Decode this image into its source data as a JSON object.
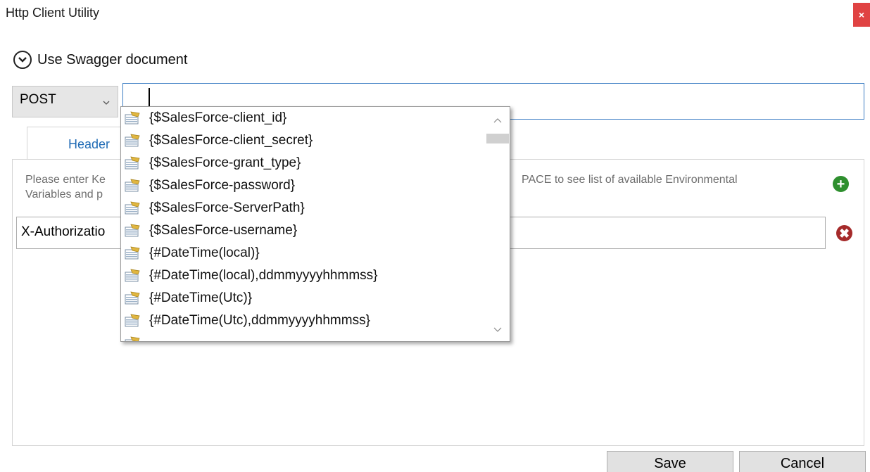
{
  "window": {
    "title": "Http Client Utility",
    "close_label": "×"
  },
  "swagger": {
    "label": "Use Swagger document"
  },
  "request": {
    "method": "POST",
    "url": ""
  },
  "tabs": [
    {
      "label": "Header"
    }
  ],
  "headers_panel": {
    "hint_left_line1": "Please enter Ke",
    "hint_left_line2": "Variables and p",
    "hint_right": "PACE to see list of available Environmental",
    "key_value": "X-Authorizatio"
  },
  "autocomplete": {
    "items": [
      "{$SalesForce-client_id}",
      "{$SalesForce-client_secret}",
      "{$SalesForce-grant_type}",
      "{$SalesForce-password}",
      "{$SalesForce-ServerPath}",
      "{$SalesForce-username}",
      "{#DateTime(local)}",
      "{#DateTime(local),ddmmyyyyhhmmss}",
      "{#DateTime(Utc)}",
      "{#DateTime(Utc),ddmmyyyyhhmmss}"
    ]
  },
  "buttons": {
    "save": "Save",
    "cancel": "Cancel"
  },
  "colors": {
    "close": "#e04343",
    "tab_text": "#1f6bb5",
    "add": "#2e8f2e",
    "remove": "#a52a2a",
    "focus_border": "#3c7dc4"
  }
}
